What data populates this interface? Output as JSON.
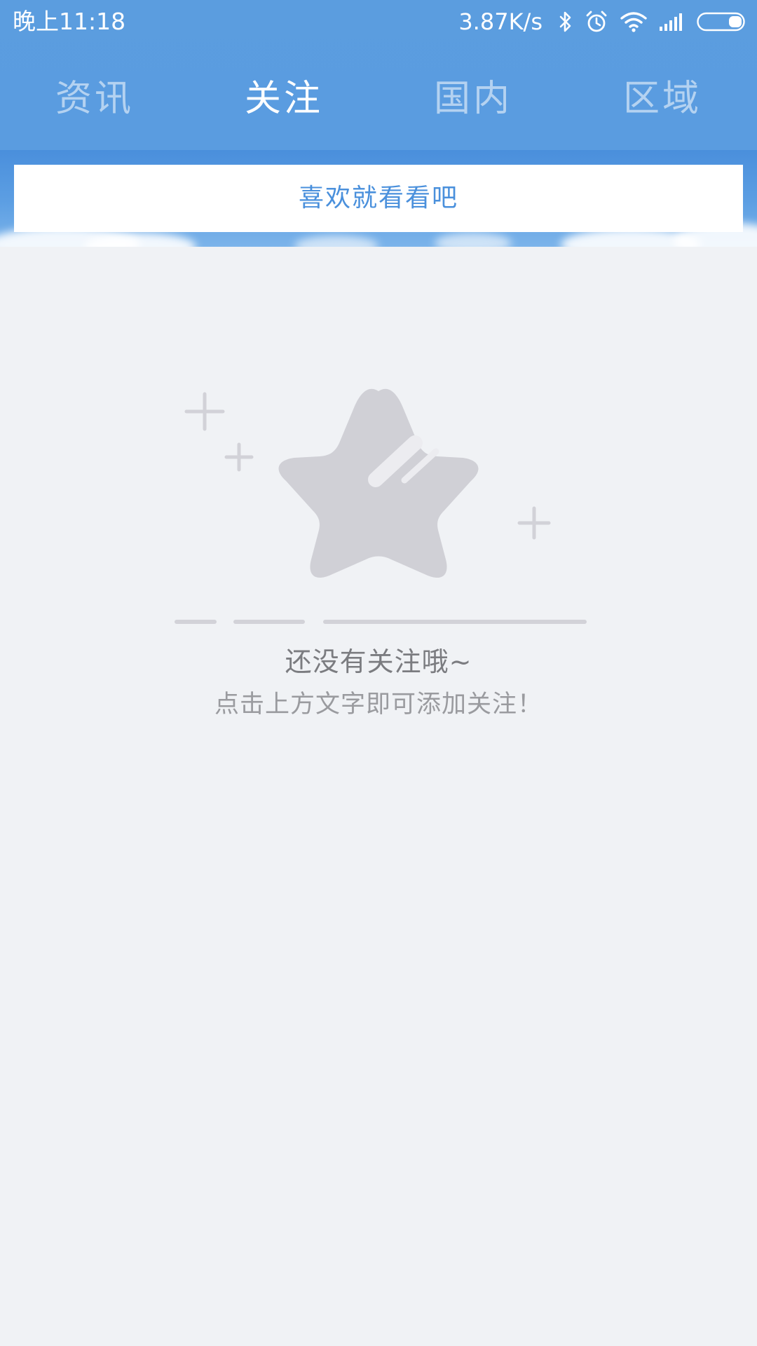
{
  "status_bar": {
    "time": "晚上11:18",
    "net_speed": "3.87K/s",
    "icons": [
      "bluetooth-icon",
      "alarm-icon",
      "wifi-icon",
      "signal-icon",
      "battery-icon"
    ]
  },
  "tabs": [
    {
      "label": "资讯",
      "active": false
    },
    {
      "label": "关注",
      "active": true
    },
    {
      "label": "国内",
      "active": false
    },
    {
      "label": "区域",
      "active": false
    }
  ],
  "banner": {
    "text": "喜欢就看看吧"
  },
  "empty_state": {
    "icon": "star-icon",
    "title": "还没有关注哦~",
    "subtitle": "点击上方文字即可添加关注！"
  },
  "colors": {
    "header_blue": "#5b9ddf",
    "banner_text": "#4a90dc",
    "background": "#f0f2f5",
    "illustration_gray": "#d0d0d6"
  }
}
